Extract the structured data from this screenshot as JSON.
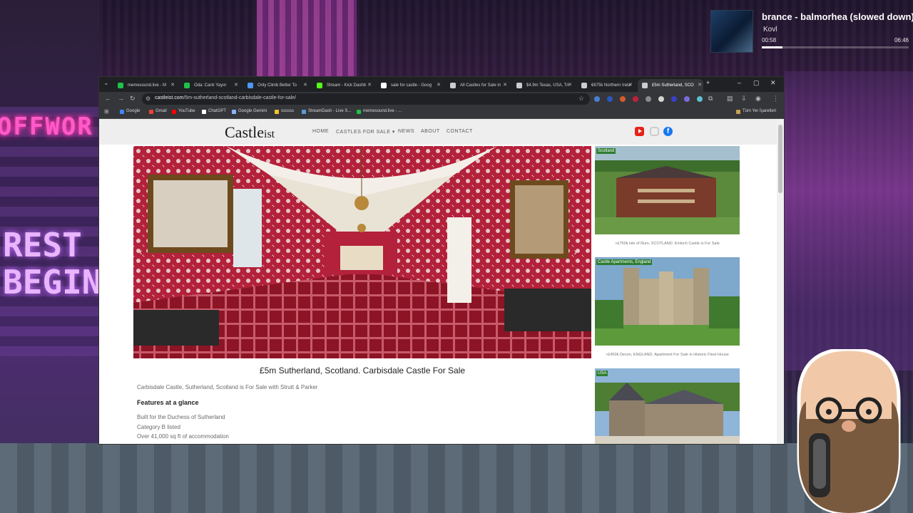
{
  "now_playing": {
    "title": "brance - balmorhea (slowed down)",
    "artist": "Kovl",
    "elapsed": "00:58",
    "duration": "06:46",
    "progress": 0.14
  },
  "browser": {
    "tabs": [
      {
        "label": "memesound.live - M",
        "icon_color": "#1ec14a"
      },
      {
        "label": "Oda: Canlı Yayın",
        "icon_color": "#1ec14a"
      },
      {
        "label": "Only Climb Better To",
        "icon_color": "#4a9af0"
      },
      {
        "label": "Stream - Kick Dashb",
        "icon_color": "#53fc18"
      },
      {
        "label": "sale for castle - Goog",
        "icon_color": "#ffffff"
      },
      {
        "label": "All Castles for Sale in",
        "icon_color": "#cccccc"
      },
      {
        "label": "$4.9m Texas, USA, Tri",
        "icon_color": "#cccccc"
      },
      {
        "label": "€675k Northern Irela",
        "icon_color": "#cccccc"
      },
      {
        "label": "£5m Sutherland, SCO",
        "icon_color": "#cccccc",
        "active": true
      }
    ],
    "url_domain": "castleist.com",
    "url_path": "/5m-sutherland-scotland-carbisdale-castle-for-sale/",
    "bookmarks": [
      {
        "label": "Google",
        "icon_color": "#4285f4"
      },
      {
        "label": "Gmail",
        "icon_color": "#ea4335"
      },
      {
        "label": "YouTube",
        "icon_color": "#ff0000"
      },
      {
        "label": "ChatGPT",
        "icon_color": "#ffffff"
      },
      {
        "label": "Google Gemini",
        "icon_color": "#8ab4f8"
      },
      {
        "label": "ssssss",
        "icon_color": "#f1c232"
      },
      {
        "label": "StreamDash - Live S...",
        "icon_color": "#5b9bd5"
      },
      {
        "label": "memesound.live - ...",
        "icon_color": "#1ec14a"
      }
    ],
    "all_bookmarks": "Tüm Yer İşaretleri"
  },
  "site": {
    "logo_main": "Castle",
    "logo_suffix": "ist",
    "nav": [
      "HOME",
      "CASTLES FOR SALE ▾",
      "NEWS",
      "ABOUT",
      "CONTACT"
    ],
    "post_title": "£5m Sutherland, Scotland.  Carbisdale Castle For Sale",
    "intro": "Carbisdale Castle, Sutherland, Scotland is For Sale with Strutt & Parker",
    "features_heading": "Features at a glance",
    "features": [
      "Built for the Duchess of Sutherland",
      "Category B listed",
      "Over 41,000 sq ft of accommodation"
    ],
    "cards": [
      {
        "tag": "Scotland",
        "caption": ">£750k Isle of Rum, SCOTLAND. Kinloch Castle is For Sale"
      },
      {
        "tag": "Castle Apartments, England",
        "caption": ">£450k Devon, ENGLAND. Apartment For Sale in Historic Fleet House"
      },
      {
        "tag": "USA",
        "caption": ""
      }
    ]
  },
  "colors": {
    "accent_green": "#2e7d32",
    "youtube_red": "#e62117",
    "facebook_blue": "#1877f2"
  }
}
